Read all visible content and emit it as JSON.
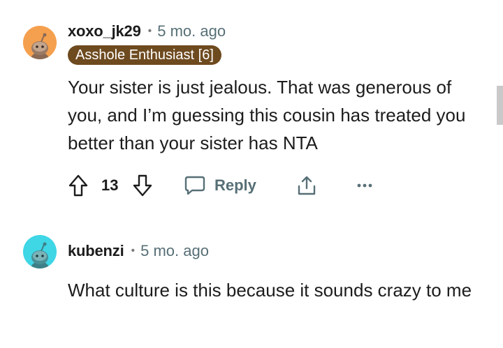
{
  "comments": [
    {
      "username": "xoxo_jk29",
      "separator": "•",
      "time": "5 mo. ago",
      "flair": "Asshole Enthusiast [6]",
      "body": "Your sister is just jealous. That was generous of you, and I’m guessing this cousin has treated you better than your sister has NTA",
      "score": "13",
      "reply_label": "Reply",
      "avatar_color": "#f5a04f",
      "avatar_icon": "snoo-avatar-icon"
    },
    {
      "username": "kubenzi",
      "separator": "•",
      "time": "5 mo. ago",
      "body": "What culture is this because it sounds crazy to me",
      "avatar_color": "#3fd6e6",
      "avatar_icon": "snoo-avatar-icon"
    }
  ],
  "colors": {
    "flair_bg": "#6e4a1f",
    "meta_gray": "#576f76",
    "text": "#1c1c1c"
  }
}
